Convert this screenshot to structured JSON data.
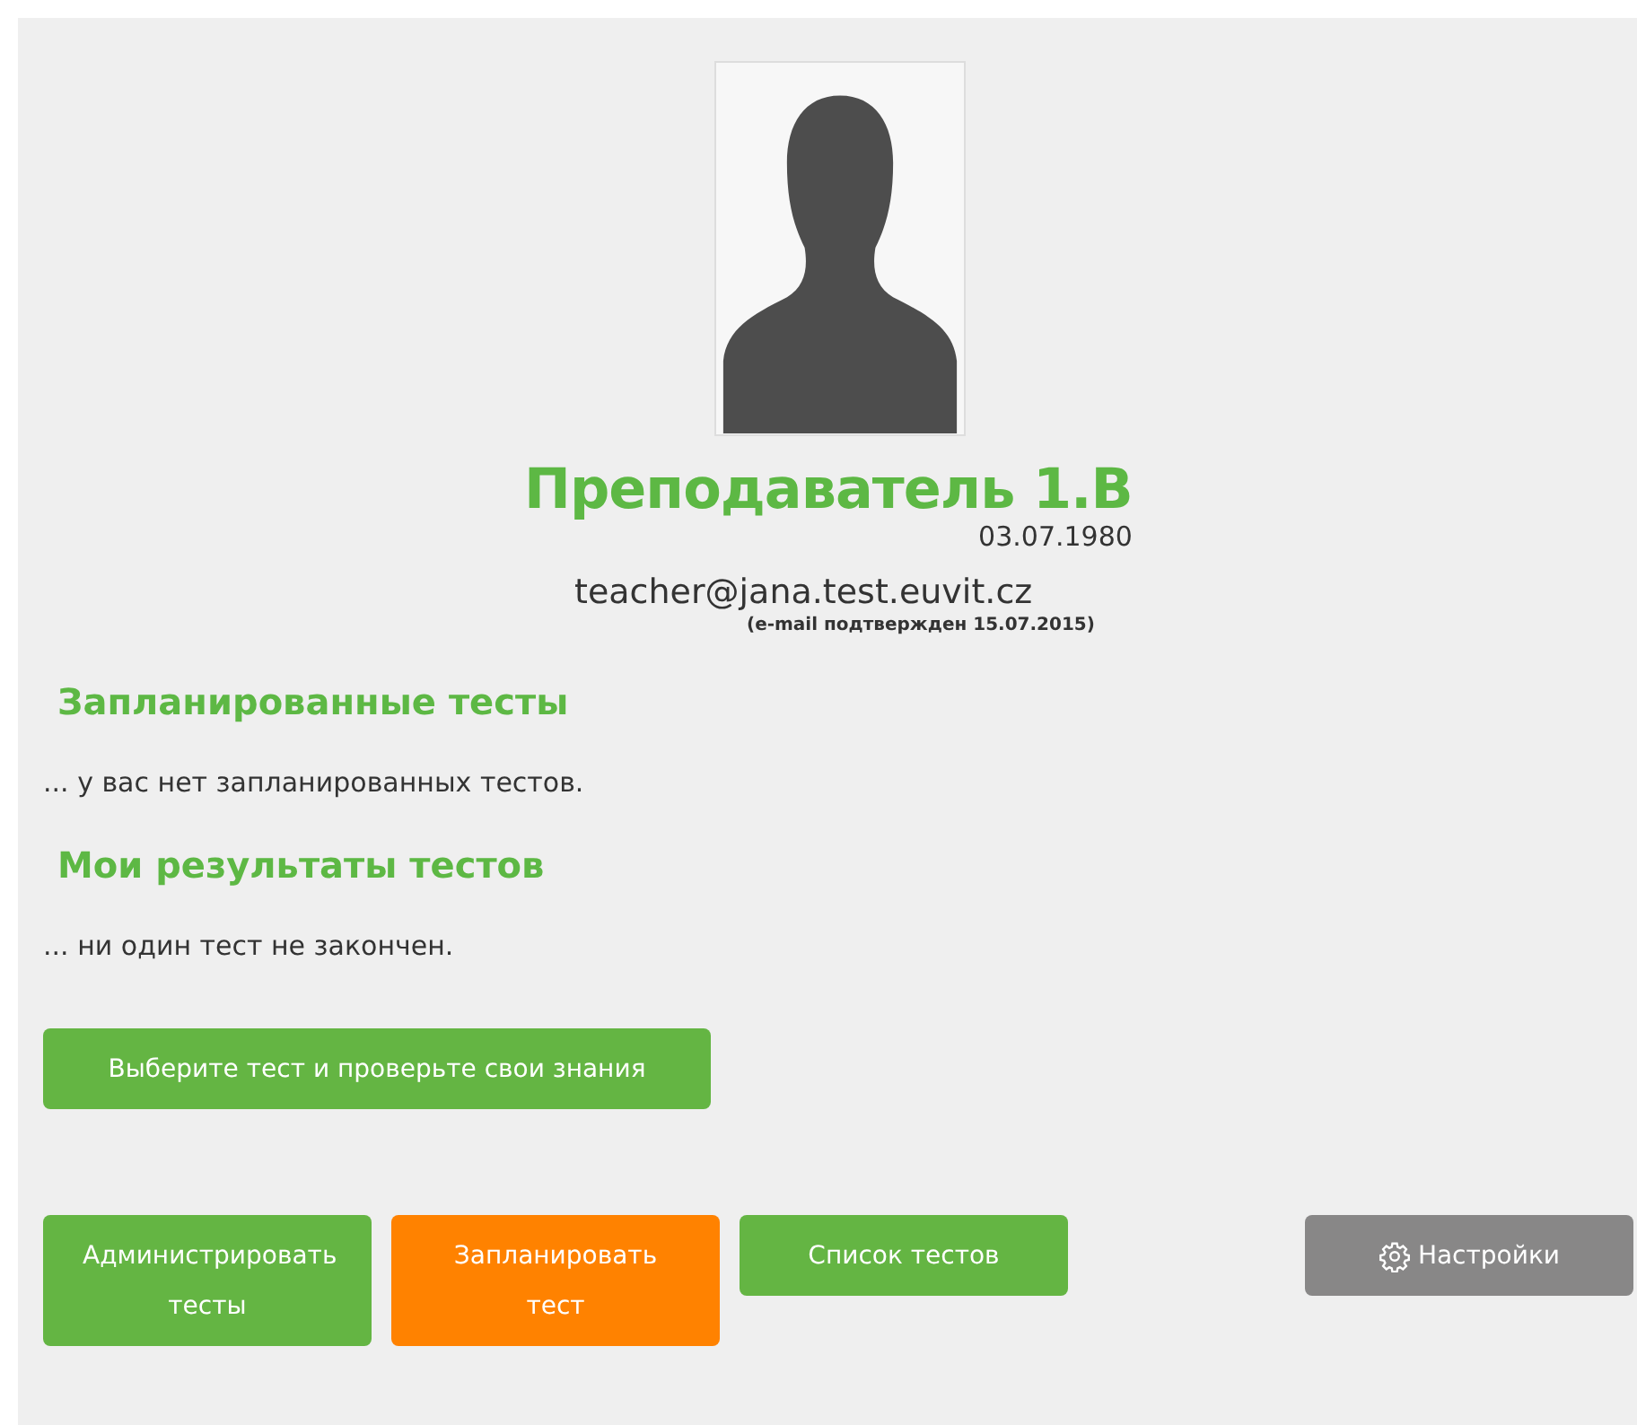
{
  "profile": {
    "name": "Преподаватель 1.В",
    "birth_date": "03.07.1980",
    "email": "teacher@jana.test.euvit.cz",
    "email_note": "(e-mail подтвержден 15.07.2015)"
  },
  "sections": [
    {
      "heading": "Запланированные тесты",
      "text": "... у вас нет запланированных тестов."
    },
    {
      "heading": "Мои результаты тестов",
      "text": "... ни один тест не закончен."
    }
  ],
  "main_button": {
    "label": "Выберите тест и проверьте свои знания",
    "color": "#64b543"
  },
  "buttons": [
    {
      "label": "Администрировать тесты",
      "kind": "text",
      "color": "#64b543"
    },
    {
      "label": "Запланировать тест",
      "kind": "text",
      "color": "#ff8200"
    },
    {
      "label": "Список тестов",
      "kind": "text",
      "color": "#64b543"
    },
    {
      "label": "Настройки",
      "kind": "settings",
      "color": "#888787"
    }
  ]
}
